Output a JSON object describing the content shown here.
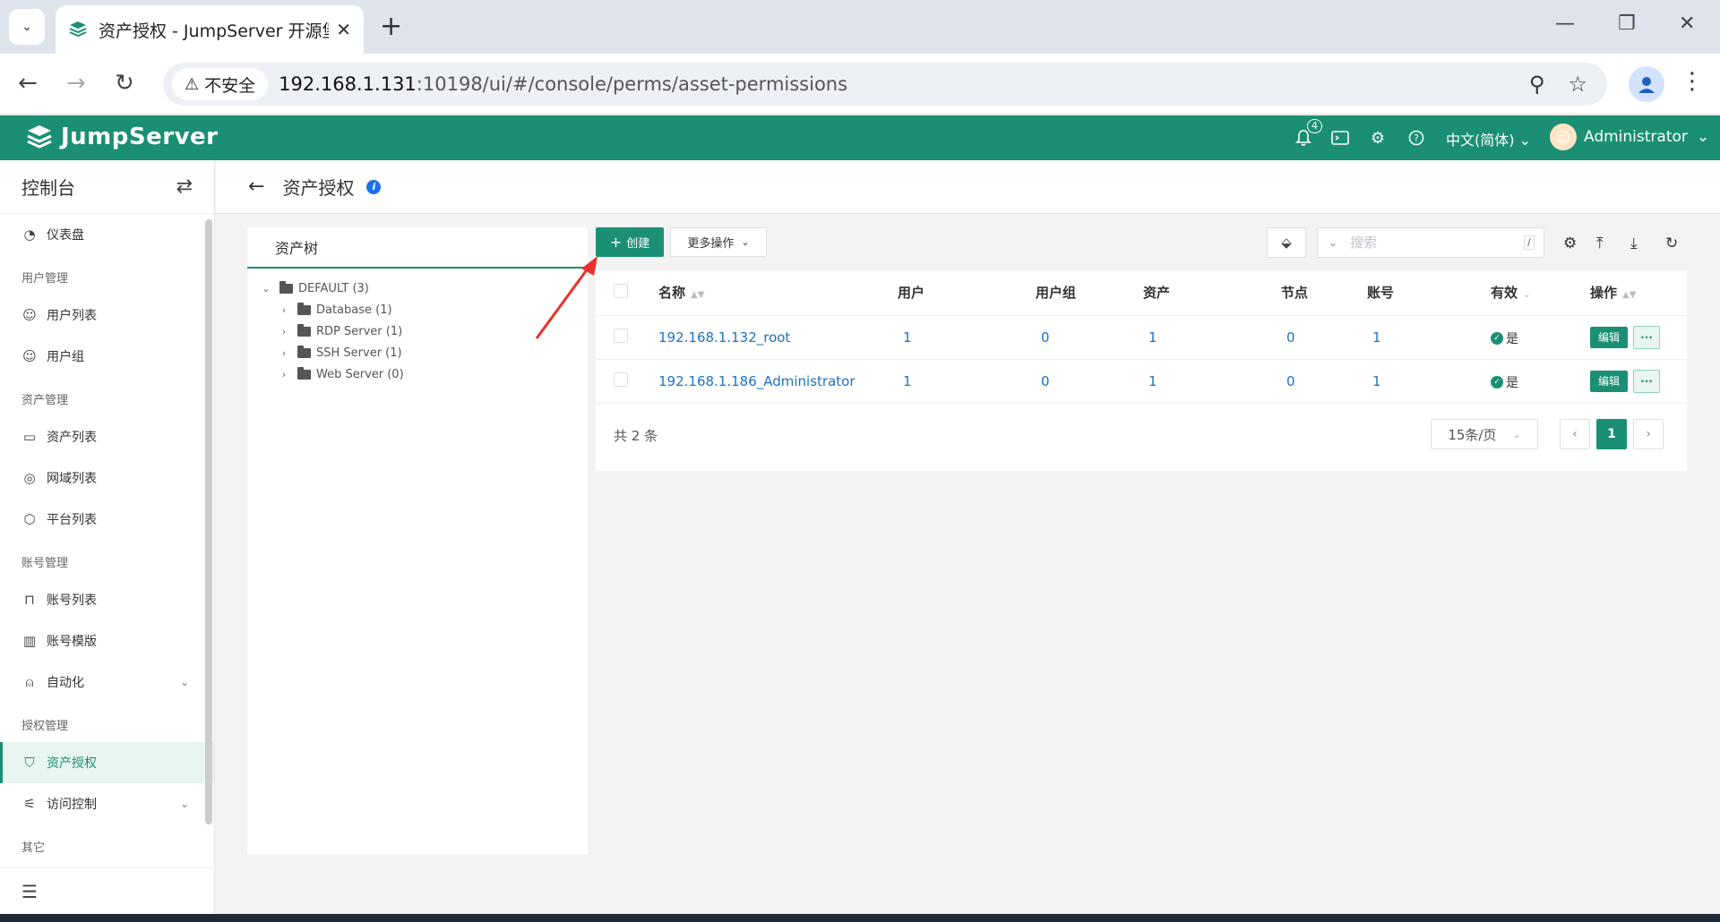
{
  "browser": {
    "tab_title": "资产授权 - JumpServer 开源堡",
    "url_label": "不安全",
    "url_host": "192.168.1.131",
    "url_path": ":10198/ui/#/console/perms/asset-permissions"
  },
  "header": {
    "brand": "JumpServer",
    "notification_count": "4",
    "language": "中文(简体)",
    "user": "Administrator",
    "accent_color": "#1a8f73"
  },
  "sidebar": {
    "title": "控制台",
    "items": [
      {
        "type": "item",
        "label": "仪表盘"
      },
      {
        "type": "group",
        "label": "用户管理"
      },
      {
        "type": "item",
        "label": "用户列表"
      },
      {
        "type": "item",
        "label": "用户组"
      },
      {
        "type": "group",
        "label": "资产管理"
      },
      {
        "type": "item",
        "label": "资产列表"
      },
      {
        "type": "item",
        "label": "网域列表"
      },
      {
        "type": "item",
        "label": "平台列表"
      },
      {
        "type": "group",
        "label": "账号管理"
      },
      {
        "type": "item",
        "label": "账号列表"
      },
      {
        "type": "item",
        "label": "账号模版"
      },
      {
        "type": "item",
        "label": "自动化"
      },
      {
        "type": "group",
        "label": "授权管理"
      },
      {
        "type": "item",
        "label": "资产授权",
        "active": true
      },
      {
        "type": "item",
        "label": "访问控制"
      },
      {
        "type": "group",
        "label": "其它"
      }
    ]
  },
  "page": {
    "title": "资产授权"
  },
  "tree": {
    "title": "资产树",
    "root": "DEFAULT (3)",
    "children": [
      "Database (1)",
      "RDP Server (1)",
      "SSH Server (1)",
      "Web Server (0)"
    ]
  },
  "toolbar": {
    "create_label": "创建",
    "more_label": "更多操作",
    "search_placeholder": "搜索",
    "search_shortcut": "/"
  },
  "table": {
    "columns": [
      "名称",
      "用户",
      "用户组",
      "资产",
      "节点",
      "账号",
      "有效",
      "操作"
    ],
    "rows": [
      {
        "name": "192.168.1.132_root",
        "users": "1",
        "user_groups": "0",
        "assets": "1",
        "nodes": "0",
        "accounts": "1",
        "valid": "是"
      },
      {
        "name": "192.168.1.186_Administrator",
        "users": "1",
        "user_groups": "0",
        "assets": "1",
        "nodes": "0",
        "accounts": "1",
        "valid": "是"
      }
    ],
    "edit_label": "编辑",
    "more_label": "···"
  },
  "pagination": {
    "total": "共 2 条",
    "page_size": "15条/页",
    "current_page": "1"
  }
}
